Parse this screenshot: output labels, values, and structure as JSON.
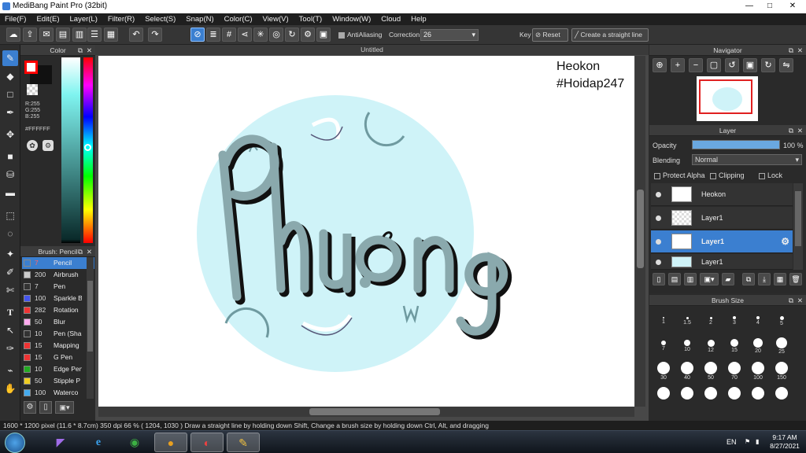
{
  "window": {
    "title": "MediBang Paint Pro (32bit)",
    "minimize": "—",
    "maximize": "□",
    "close": "✕"
  },
  "menu": [
    "File(F)",
    "Edit(E)",
    "Layer(L)",
    "Filter(R)",
    "Select(S)",
    "Snap(N)",
    "Color(C)",
    "View(V)",
    "Tool(T)",
    "Window(W)",
    "Cloud",
    "Help"
  ],
  "toolbar": {
    "antialiasing_label": "AntiAliasing",
    "correction_label": "Correction",
    "correction_value": "26",
    "key_label": "Key",
    "reset_label": "Reset",
    "straight_line_label": "Create a straight line"
  },
  "color_panel": {
    "title": "Color",
    "r": "R:255",
    "g": "G:255",
    "b": "B:255",
    "hex": "#FFFFFF",
    "primary_color": "#ff0000",
    "secondary_color": "#ffffff"
  },
  "brush_panel": {
    "title": "Brush: Pencil",
    "items": [
      {
        "size": "7",
        "name": "Pencil",
        "color": "#3b7fd0"
      },
      {
        "size": "200",
        "name": "Airbrush",
        "color": "#cccccc"
      },
      {
        "size": "7",
        "name": "Pen",
        "color": "#333333"
      },
      {
        "size": "100",
        "name": "Sparkle B",
        "color": "#4455ee"
      },
      {
        "size": "282",
        "name": "Rotation",
        "color": "#ee3333"
      },
      {
        "size": "50",
        "name": "Blur",
        "color": "#ffaaee"
      },
      {
        "size": "10",
        "name": "Pen (Sha",
        "color": "#333333"
      },
      {
        "size": "15",
        "name": "Mapping",
        "color": "#ee3333"
      },
      {
        "size": "15",
        "name": "G Pen",
        "color": "#ee3333"
      },
      {
        "size": "10",
        "name": "Edge Pen",
        "color": "#22aa22"
      },
      {
        "size": "50",
        "name": "Stipple P",
        "color": "#eecc22"
      },
      {
        "size": "100",
        "name": "Waterco",
        "color": "#44aaee"
      }
    ]
  },
  "canvas": {
    "tab_title": "Untitled",
    "watermark_line1": "Heokon",
    "watermark_line2": "#Hoidap247",
    "circle_color": "#cff3f8",
    "lettering_color": "#8aa9ad"
  },
  "navigator": {
    "title": "Navigator"
  },
  "layer_panel": {
    "title": "Layer",
    "opacity_label": "Opacity",
    "opacity_value": "100 %",
    "opacity_fraction": 1.0,
    "blending_label": "Blending",
    "blending_value": "Normal",
    "protect_alpha": "Protect Alpha",
    "clipping": "Clipping",
    "lock": "Lock",
    "layers": [
      {
        "name": "Heokon"
      },
      {
        "name": "Layer1"
      },
      {
        "name": "Layer1"
      },
      {
        "name": "Layer1"
      }
    ]
  },
  "brush_size_panel": {
    "title": "Brush Size",
    "sizes": [
      "1",
      "1.5",
      "2",
      "3",
      "4",
      "5",
      "7",
      "10",
      "12",
      "15",
      "20",
      "25",
      "30",
      "40",
      "50",
      "70",
      "100",
      "150",
      "",
      "",
      "",
      "",
      "",
      ""
    ]
  },
  "status": {
    "text": "1600 * 1200 pixel  (11.6 * 8.7cm)  350 dpi  66 %  ( 1204, 1030 )  Draw a straight line by holding down Shift, Change a brush size by holding down Ctrl, Alt, and dragging"
  },
  "taskbar": {
    "lang": "EN",
    "time": "9:17 AM",
    "date": "8/27/2021"
  }
}
